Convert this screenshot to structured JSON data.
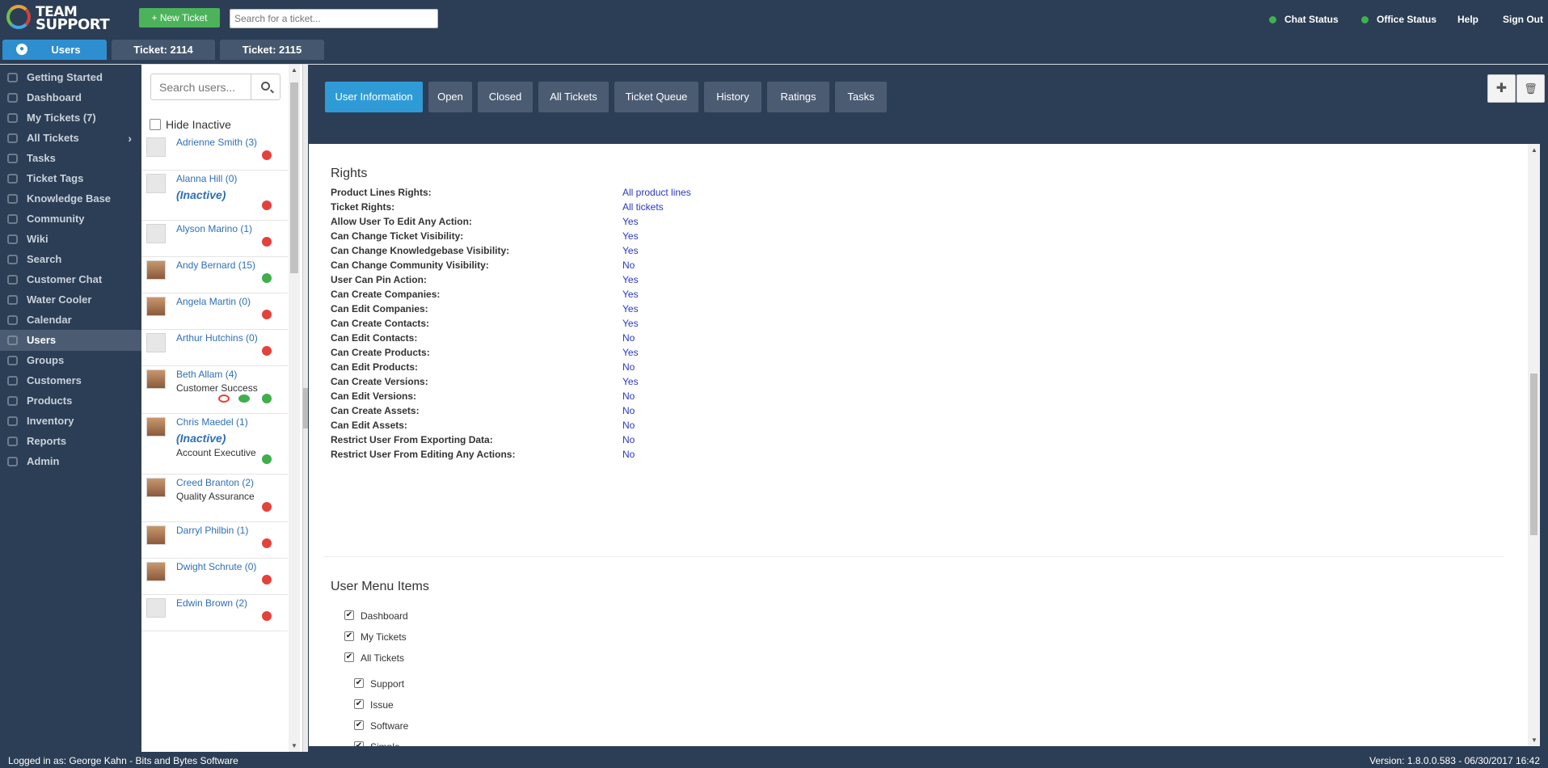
{
  "app": {
    "logo_text_1": "TEAM",
    "logo_text_2": "SUPPORT"
  },
  "topbar": {
    "new_ticket_label": "+ New Ticket",
    "search_placeholder": "Search for a ticket...",
    "chat_status": "Chat Status",
    "office_status": "Office Status",
    "help": "Help",
    "sign_out": "Sign Out",
    "status_color": "#3cb44b"
  },
  "tabs": [
    {
      "label": "Users",
      "active": true
    },
    {
      "label": "Ticket: 2114"
    },
    {
      "label": "Ticket: 2115"
    }
  ],
  "nav": [
    {
      "label": "Getting Started",
      "icon": "arrow-right-icon"
    },
    {
      "label": "Dashboard",
      "icon": "dashboard-icon"
    },
    {
      "label": "My Tickets (7)",
      "icon": "ticket-icon"
    },
    {
      "label": "All Tickets",
      "icon": "tickets-icon",
      "expandable": true
    },
    {
      "label": "Tasks",
      "icon": "check-icon"
    },
    {
      "label": "Ticket Tags",
      "icon": "tag-icon"
    },
    {
      "label": "Knowledge Base",
      "icon": "puzzle-icon"
    },
    {
      "label": "Community",
      "icon": "comments-icon"
    },
    {
      "label": "Wiki",
      "icon": "book-icon"
    },
    {
      "label": "Search",
      "icon": "search-icon"
    },
    {
      "label": "Customer Chat",
      "icon": "chat-icon"
    },
    {
      "label": "Water Cooler",
      "icon": "drop-icon"
    },
    {
      "label": "Calendar",
      "icon": "calendar-icon"
    },
    {
      "label": "Users",
      "icon": "user-icon",
      "active": true
    },
    {
      "label": "Groups",
      "icon": "group-icon"
    },
    {
      "label": "Customers",
      "icon": "building-icon"
    },
    {
      "label": "Products",
      "icon": "cart-icon"
    },
    {
      "label": "Inventory",
      "icon": "truck-icon"
    },
    {
      "label": "Reports",
      "icon": "pie-chart-icon"
    },
    {
      "label": "Admin",
      "icon": "gear-icon"
    }
  ],
  "user_panel": {
    "search_placeholder": "Search users...",
    "hide_inactive_label": "Hide Inactive",
    "users": [
      {
        "name": "Adrienne Smith (3)",
        "status": "red"
      },
      {
        "name": "Alanna Hill (0)",
        "inactive": "(Inactive)",
        "status": "red"
      },
      {
        "name": "Alyson Marino (1)",
        "status": "red"
      },
      {
        "name": "Andy Bernard (15)",
        "status": "green",
        "photo": true
      },
      {
        "name": "Angela Martin (0)",
        "status": "red",
        "photo": true
      },
      {
        "name": "Arthur Hutchins (0)",
        "status": "red"
      },
      {
        "name": "Beth Allam (4)",
        "title": "Customer Success",
        "status": "green",
        "photo": true,
        "chat": true
      },
      {
        "name": "Chris Maedel (1)",
        "inactive": "(Inactive)",
        "title": "Account Executive",
        "status": "green",
        "photo": true
      },
      {
        "name": "Creed Branton (2)",
        "title": "Quality Assurance",
        "status": "red",
        "photo": true
      },
      {
        "name": "Darryl Philbin (1)",
        "status": "red",
        "photo": true
      },
      {
        "name": "Dwight Schrute (0)",
        "status": "red",
        "photo": true
      },
      {
        "name": "Edwin Brown (2)",
        "status": "red"
      }
    ]
  },
  "detail_tabs": [
    {
      "label": "User Information",
      "active": true
    },
    {
      "label": "Open"
    },
    {
      "label": "Closed"
    },
    {
      "label": "All Tickets"
    },
    {
      "label": "Ticket Queue"
    },
    {
      "label": "History"
    },
    {
      "label": "Ratings"
    },
    {
      "label": "Tasks"
    }
  ],
  "rights": {
    "title": "Rights",
    "items": [
      {
        "label": "Product Lines Rights:",
        "value": "All product lines"
      },
      {
        "label": "Ticket Rights:",
        "value": "All tickets"
      },
      {
        "label": "Allow User To Edit Any Action:",
        "value": "Yes"
      },
      {
        "label": "Can Change Ticket Visibility:",
        "value": "Yes"
      },
      {
        "label": "Can Change Knowledgebase Visibility:",
        "value": "Yes"
      },
      {
        "label": "Can Change Community Visibility:",
        "value": "No"
      },
      {
        "label": "User Can Pin Action:",
        "value": "Yes"
      },
      {
        "label": "Can Create Companies:",
        "value": "Yes"
      },
      {
        "label": "Can Edit Companies:",
        "value": "Yes"
      },
      {
        "label": "Can Create Contacts:",
        "value": "Yes"
      },
      {
        "label": "Can Edit Contacts:",
        "value": "No"
      },
      {
        "label": "Can Create Products:",
        "value": "Yes"
      },
      {
        "label": "Can Edit Products:",
        "value": "No"
      },
      {
        "label": "Can Create Versions:",
        "value": "Yes"
      },
      {
        "label": "Can Edit Versions:",
        "value": "No"
      },
      {
        "label": "Can Create Assets:",
        "value": "No"
      },
      {
        "label": "Can Edit Assets:",
        "value": "No"
      },
      {
        "label": "Restrict User From Exporting Data:",
        "value": "No"
      },
      {
        "label": "Restrict User From Editing Any Actions:",
        "value": "No"
      }
    ]
  },
  "user_menu": {
    "title": "User Menu Items",
    "items": [
      {
        "label": "Dashboard",
        "checked": true,
        "indent": 0
      },
      {
        "label": "My Tickets",
        "checked": true,
        "indent": 0
      },
      {
        "label": "All Tickets",
        "checked": true,
        "indent": 0
      },
      {
        "label": "Support",
        "checked": true,
        "indent": 1
      },
      {
        "label": "Issue",
        "checked": true,
        "indent": 1
      },
      {
        "label": "Software",
        "checked": true,
        "indent": 1
      },
      {
        "label": "Simple",
        "checked": true,
        "indent": 1
      }
    ]
  },
  "footer": {
    "logged_in": "Logged in as: George Kahn - Bits and Bytes Software",
    "version": "Version: 1.8.0.0.583 - 06/30/2017 16:42"
  }
}
